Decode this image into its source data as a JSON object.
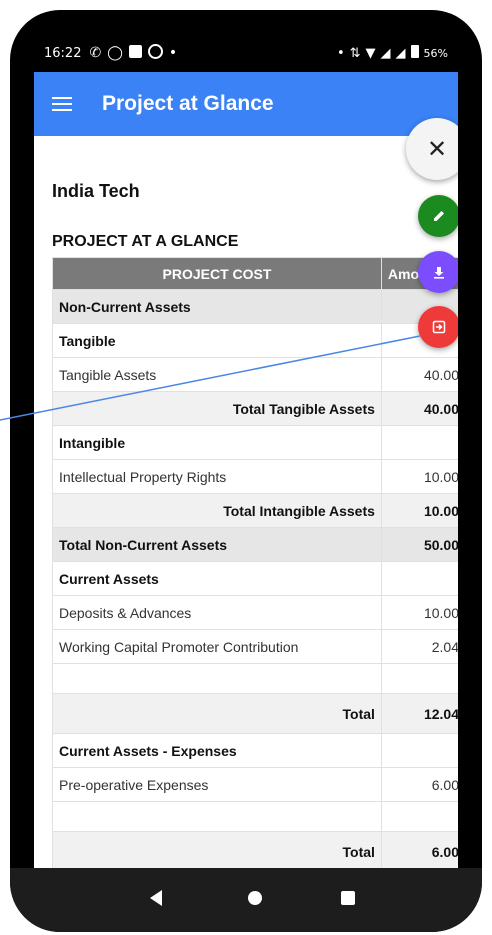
{
  "status": {
    "time": "16:22",
    "battery_label": "56%",
    "left_icons": [
      "whatsapp-icon",
      "pinterest-icon",
      "square-icon",
      "ring-icon",
      "dot-icon"
    ],
    "right_icons": [
      "dot-icon",
      "data-signal-icon",
      "wifi-icon",
      "signal-icon",
      "signal-icon",
      "battery-icon"
    ]
  },
  "appbar": {
    "title": "Project at Glance",
    "accent": "#3b82f6"
  },
  "content": {
    "company": "India Tech",
    "heading": "PROJECT AT A GLANCE"
  },
  "table": {
    "headers": [
      "PROJECT COST",
      "Amo"
    ],
    "rows": [
      {
        "label": "Non-Current Assets",
        "value": ""
      },
      {
        "label": "Tangible",
        "value": ""
      },
      {
        "label": "Tangible Assets",
        "value": "40.00"
      },
      {
        "label": "Total Tangible Assets",
        "value": "40.00"
      },
      {
        "label": "Intangible",
        "value": ""
      },
      {
        "label": "Intellectual Property Rights",
        "value": "10.00"
      },
      {
        "label": "Total Intangible Assets",
        "value": "10.00"
      },
      {
        "label": "Total Non-Current Assets",
        "value": "50.00"
      },
      {
        "label": "Current Assets",
        "value": ""
      },
      {
        "label": "Deposits & Advances",
        "value": "10.00"
      },
      {
        "label": "Working Capital Promoter Contribution",
        "value": "2.04"
      },
      {
        "label": "",
        "value": ""
      },
      {
        "label": "Total",
        "value": "12.04"
      },
      {
        "label": "Current Assets - Expenses",
        "value": ""
      },
      {
        "label": "Pre-operative Expenses",
        "value": "6.00"
      },
      {
        "label": "",
        "value": ""
      },
      {
        "label": "Total",
        "value": "6.00"
      }
    ]
  },
  "fabs": {
    "close_glyph": "✕",
    "edit_color": "#1b8a1f",
    "download_color": "#7c4dff",
    "export_color": "#ef3a3a"
  }
}
